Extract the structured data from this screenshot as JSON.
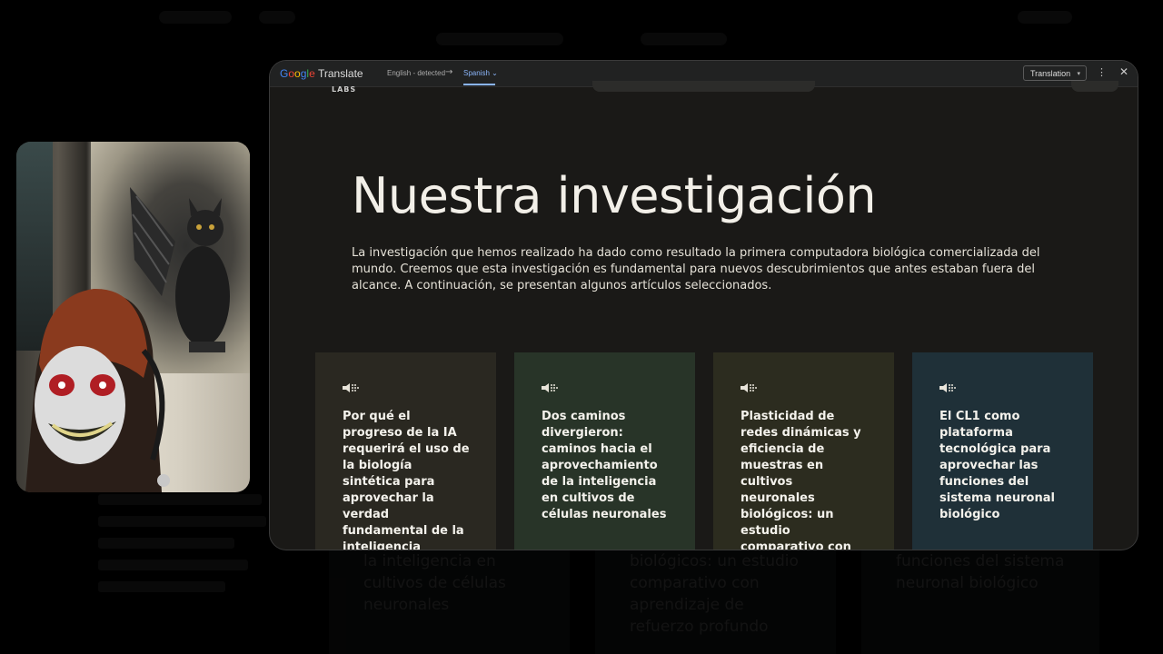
{
  "translate_bar": {
    "logo": "Google",
    "app_name": "Translate",
    "source_language": "English - detected",
    "arrow": "→",
    "target_language": "Spanish",
    "target_caret": "⌄",
    "mode": "Translation",
    "mode_caret": "▾",
    "more_icon": "⋮",
    "close_icon": "✕",
    "colors": {
      "blue": "#4285f4",
      "red": "#ea4335",
      "yellow": "#fbbc05",
      "green": "#34a853",
      "active": "#8ab4f8"
    }
  },
  "site": {
    "labs_label": "LABS",
    "title": "Nuestra investigación",
    "description": "La investigación que hemos realizado ha dado como resultado la primera computadora biológica comercializada del mundo. Creemos que esta investigación es fundamental para nuevos descubrimientos que antes estaban fuera del alcance. A continuación, se presentan algunos artículos seleccionados.",
    "cards": [
      {
        "text": "Por qué el progreso de la IA requerirá el uso de la biología sintética para aprovechar la verdad fundamental de la inteligencia",
        "color": "#2a2821",
        "icon": "speaker-dots-icon"
      },
      {
        "text": "Dos caminos divergieron: caminos hacia el aprovechamiento de la inteligencia en cultivos de células neuronales",
        "color": "#283428",
        "icon": "speaker-dots-icon"
      },
      {
        "text": "Plasticidad de redes dinámicas y eficiencia de muestras en cultivos neuronales biológicos: un estudio comparativo con aprendizaje de refuerzo profundo",
        "color": "#2c2c1f",
        "icon": "speaker-dots-icon"
      },
      {
        "text": "El CL1 como plataforma tecnológica para aprovechar las funciones del sistema neuronal biológico",
        "color": "#1f3038",
        "icon": "speaker-dots-icon"
      }
    ]
  },
  "background_page": {
    "card_texts": [
      "la inteligencia en cultivos de células neuronales",
      "biológicos: un estudio comparativo con aprendizaje de refuerzo profundo",
      "funciones del sistema neuronal biológico"
    ],
    "left_column": "la verdad fundamental de la biología sintética para aprovechar la verdad fundamental de la inteligencia"
  }
}
